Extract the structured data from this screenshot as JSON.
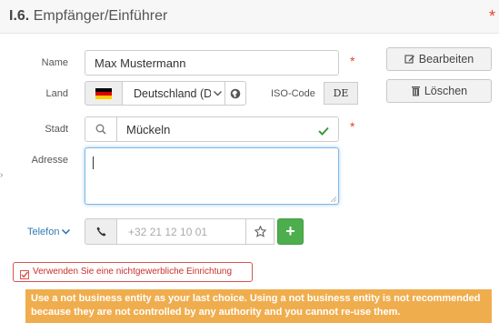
{
  "section": {
    "number": "I.6.",
    "title": "Empfänger/Einführer"
  },
  "form": {
    "name_label": "Name",
    "name_value": "Max Mustermann",
    "country_label": "Land",
    "country_value": "Deutschland (D",
    "iso_label": "ISO-Code",
    "iso_value": "DE",
    "city_label": "Stadt",
    "city_value": "Mückeln",
    "address_label": "Adresse",
    "address_value": "",
    "phone_label": "Telefon",
    "phone_placeholder": "+32 21 12 10 01",
    "required_marker": "*"
  },
  "buttons": {
    "edit_label": "Bearbeiten",
    "delete_label": "Löschen",
    "add_label": "+"
  },
  "checkbox": {
    "label": "Verwenden Sie eine nichtgewerbliche Einrichtung",
    "checked": true
  },
  "warning": {
    "text": "Use a not business entity as your last choice. Using a not business entity is not recommended because they are not controlled by any authority and you cannot re-use them."
  },
  "colors": {
    "required": "#e8432b",
    "valid": "#3c9a3c",
    "add_button": "#4cae4c",
    "warning_bg": "#f0ad4e",
    "checkbox_border": "#d9534f"
  },
  "icons": {
    "edit": "pencil-square-icon",
    "delete": "trash-icon",
    "country_flag": "germany-flag-icon",
    "globe": "globe-icon",
    "search": "search-icon",
    "valid": "checkmark-icon",
    "phone": "phone-icon",
    "favorite": "star-icon",
    "dropdown": "chevron-down-icon"
  }
}
